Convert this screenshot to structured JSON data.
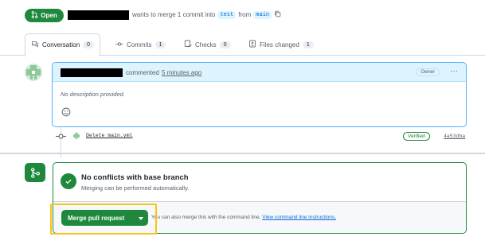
{
  "pr_header": {
    "state_label": "Open",
    "merge_text": "wants to merge 1 commit into",
    "base_branch": "test",
    "from_text": "from",
    "head_branch": "main"
  },
  "tabs": [
    {
      "label": "Conversation",
      "count": "0"
    },
    {
      "label": "Commits",
      "count": "1"
    },
    {
      "label": "Checks",
      "count": "0"
    },
    {
      "label": "Files changed",
      "count": "1"
    }
  ],
  "comment": {
    "action_text": "commented",
    "time_text": "5 minutes ago",
    "role_badge": "Owner",
    "more_label": "···",
    "body": "No description provided."
  },
  "commit": {
    "message": "Delete main.yml",
    "verified_label": "Verified",
    "sha": "4a53dba"
  },
  "merge": {
    "status_title": "No conflicts with base branch",
    "status_sub": "Merging can be performed automatically.",
    "button_label": "Merge pull request",
    "hint_text": "You can also merge this with the command line.",
    "hint_link": "View command line instructions."
  },
  "colors": {
    "green": "#1f883d",
    "blue_link": "#0969da",
    "highlight": "#f5c518"
  }
}
